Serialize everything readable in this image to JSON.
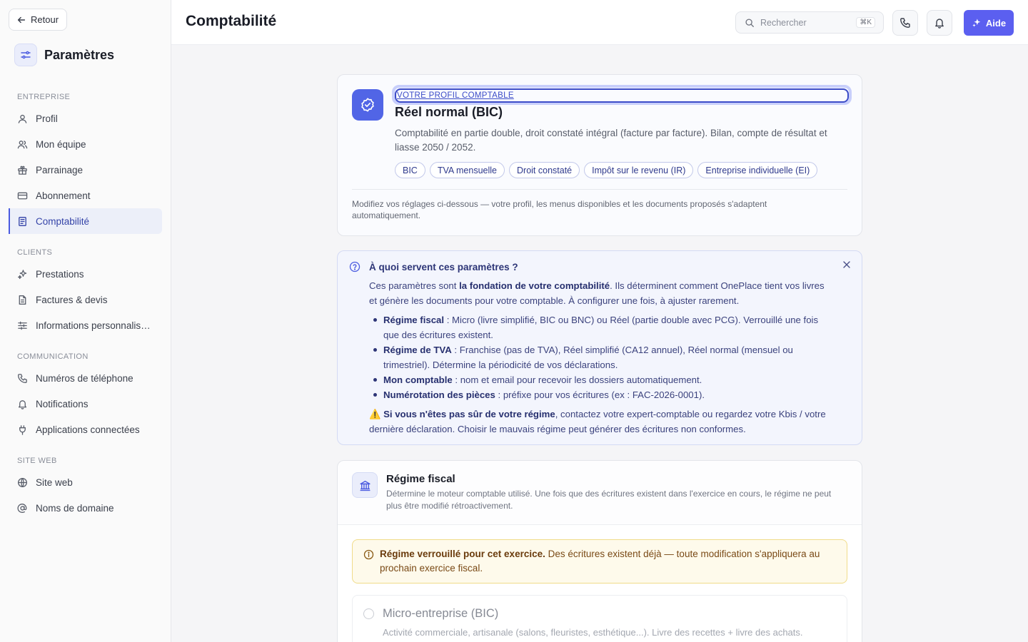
{
  "sidebar": {
    "back_label": "Retour",
    "title": "Paramètres",
    "sections": [
      {
        "label": "ENTREPRISE",
        "items": [
          {
            "label": "Profil",
            "icon": "user-icon"
          },
          {
            "label": "Mon équipe",
            "icon": "users-icon"
          },
          {
            "label": "Parrainage",
            "icon": "gift-icon"
          },
          {
            "label": "Abonnement",
            "icon": "credit-card-icon"
          },
          {
            "label": "Comptabilité",
            "icon": "ledger-icon",
            "active": true
          }
        ]
      },
      {
        "label": "CLIENTS",
        "items": [
          {
            "label": "Prestations",
            "icon": "sparkles-icon"
          },
          {
            "label": "Factures & devis",
            "icon": "file-icon"
          },
          {
            "label": "Informations personnalisées",
            "icon": "sliders-icon"
          }
        ]
      },
      {
        "label": "COMMUNICATION",
        "items": [
          {
            "label": "Numéros de téléphone",
            "icon": "phone-icon"
          },
          {
            "label": "Notifications",
            "icon": "bell-icon"
          },
          {
            "label": "Applications connectées",
            "icon": "plug-icon"
          }
        ]
      },
      {
        "label": "SITE WEB",
        "items": [
          {
            "label": "Site web",
            "icon": "globe-icon"
          },
          {
            "label": "Noms de domaine",
            "icon": "at-icon"
          }
        ]
      }
    ]
  },
  "header": {
    "title": "Comptabilité",
    "search_placeholder": "Rechercher",
    "search_shortcut": "⌘K",
    "help_label": "Aide",
    "accent_color": "#5b5ff0"
  },
  "profile": {
    "eyebrow": "VOTRE PROFIL COMPTABLE",
    "regime": "Réel normal (BIC)",
    "description": "Comptabilité en partie double, droit constaté intégral (facture par facture). Bilan, compte de résultat et liasse 2050 / 2052.",
    "tags": [
      "BIC",
      "TVA mensuelle",
      "Droit constaté",
      "Impôt sur le revenu (IR)",
      "Entreprise individuelle (EI)"
    ],
    "note": "Modifiez vos réglages ci-dessous — votre profil, les menus disponibles et les documents proposés s'adaptent automatiquement."
  },
  "help": {
    "title": "À quoi servent ces paramètres ?",
    "intro_pre": "Ces paramètres sont ",
    "intro_bold": "la fondation de votre comptabilité",
    "intro_post": ". Ils déterminent comment OnePlace tient vos livres et génère les documents pour votre comptable. À configurer une fois, à ajuster rarement.",
    "items": [
      {
        "term": "Régime fiscal",
        "text": " : Micro (livre simplifié, BIC ou BNC) ou Réel (partie double avec PCG). Verrouillé une fois que des écritures existent."
      },
      {
        "term": "Régime de TVA",
        "text": " : Franchise (pas de TVA), Réel simplifié (CA12 annuel), Réel normal (mensuel ou trimestriel). Détermine la périodicité de vos déclarations."
      },
      {
        "term": "Mon comptable",
        "text": " : nom et email pour recevoir les dossiers automatiquement."
      },
      {
        "term": "Numérotation des pièces",
        "text": " : préfixe pour vos écritures (ex : FAC-2026-0001)."
      }
    ],
    "warning_emoji": "⚠️",
    "warning_bold": "Si vous n'êtes pas sûr de votre régime",
    "warning_text": ", contactez votre expert-comptable ou regardez votre Kbis / votre dernière déclaration. Choisir le mauvais régime peut générer des écritures non conformes."
  },
  "fiscal": {
    "title": "Régime fiscal",
    "description": "Détermine le moteur comptable utilisé. Une fois que des écritures existent dans l'exercice en cours, le régime ne peut plus être modifié rétroactivement.",
    "lock_bold": "Régime verrouillé pour cet exercice.",
    "lock_text": " Des écritures existent déjà — toute modification s'appliquera au prochain exercice fiscal.",
    "options": [
      {
        "title": "Micro-entreprise (BIC)",
        "description": "Activité commerciale, artisanale (salons, fleuristes, esthétique...). Livre des recettes + livre des achats.",
        "selected": false
      }
    ]
  }
}
